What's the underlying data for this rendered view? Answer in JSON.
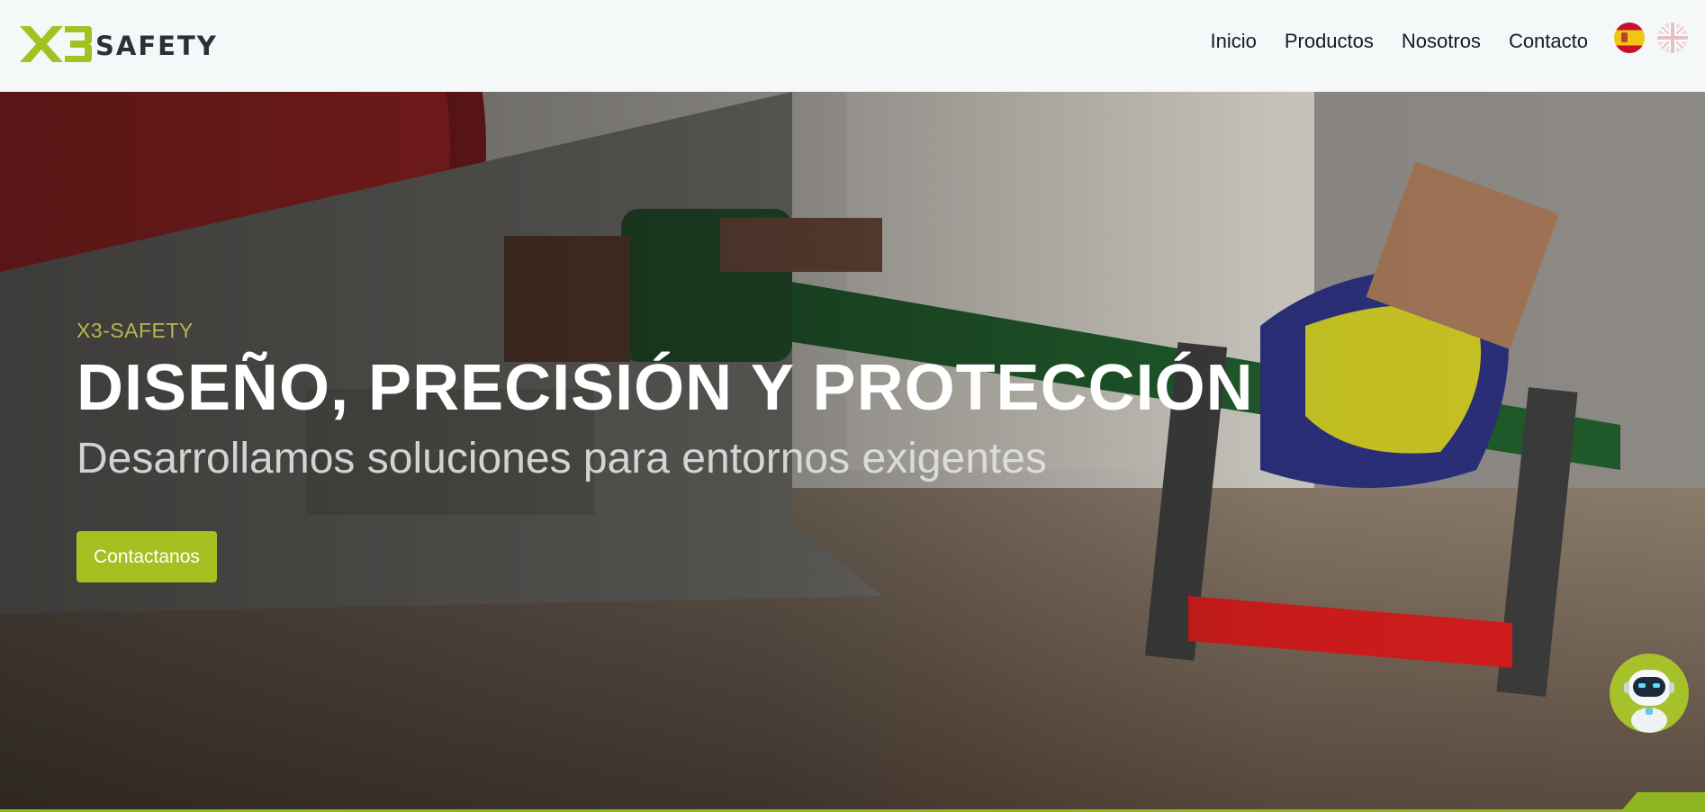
{
  "brand": {
    "name": "SAFETY",
    "mark": "X3",
    "accent_color": "#a4c121"
  },
  "nav": {
    "items": [
      {
        "label": "Inicio"
      },
      {
        "label": "Productos"
      },
      {
        "label": "Nosotros"
      },
      {
        "label": "Contacto"
      }
    ],
    "languages": [
      {
        "icon": "spain-flag-icon"
      },
      {
        "icon": "uk-flag-icon"
      }
    ]
  },
  "hero": {
    "kicker": "X3-SAFETY",
    "title": "DISEÑO, PRECISIÓN Y PROTECCIÓN",
    "subtitle": "Desarrollamos soluciones para entornos exigentes",
    "cta_label": "Contactanos"
  },
  "chat": {
    "icon": "robot-assistant-icon"
  }
}
